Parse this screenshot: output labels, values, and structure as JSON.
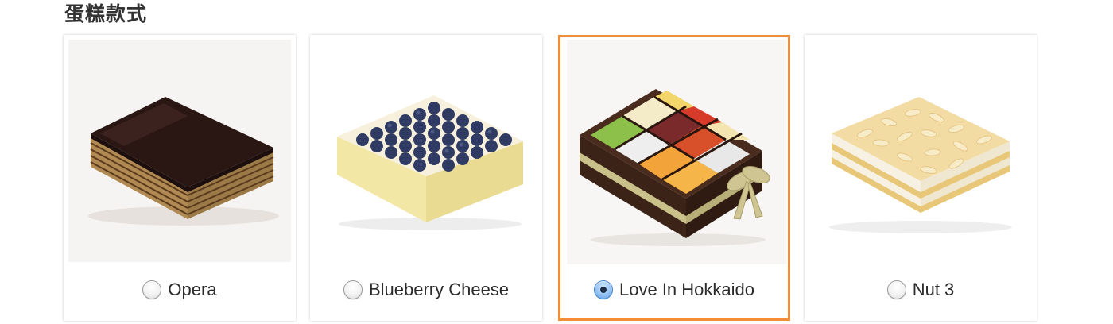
{
  "section": {
    "title": "蛋糕款式"
  },
  "options": [
    {
      "label": "Opera",
      "icon": "opera-cake-photo",
      "selected": false
    },
    {
      "label": "Blueberry Cheese",
      "icon": "blueberry-cheese-cake-photo",
      "selected": false
    },
    {
      "label": "Love In Hokkaido",
      "icon": "love-in-hokkaido-cake-photo",
      "selected": true
    },
    {
      "label": "Nut 3",
      "icon": "nut-3-cake-photo",
      "selected": false
    }
  ],
  "colors": {
    "selected_border": "#f18e37",
    "radio_checked": "#5a98de",
    "text": "#2b2b2b"
  }
}
